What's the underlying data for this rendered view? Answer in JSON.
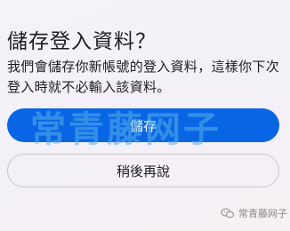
{
  "dialog": {
    "title": "儲存登入資料？",
    "description": "我們會儲存你新帳號的登入資料，這樣你下次登入時就不必輸入該資料。",
    "save_label": "儲存",
    "later_label": "稍後再說"
  },
  "overlay": {
    "watermark_text": "常青藤网子",
    "footer_badge_text": "常青藤网子",
    "footer_badge_icon": "chat-bubbles-icon"
  },
  "colors": {
    "accent": "#0866e5",
    "background": "#f4f1f7",
    "text": "#1c1e21",
    "secondary_border": "#c9c7cc"
  }
}
